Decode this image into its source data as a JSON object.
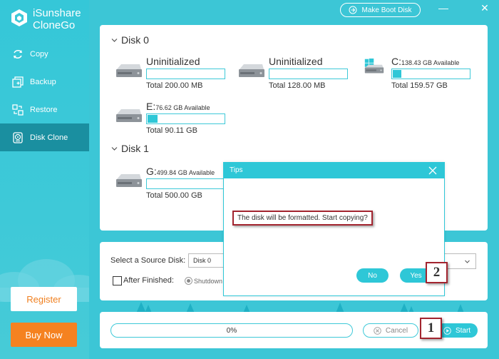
{
  "app": {
    "name_line1": "iSunshare",
    "name_line2": "CloneGo"
  },
  "sidebar": {
    "items": [
      {
        "label": "Copy",
        "icon": "copy-icon",
        "active": false
      },
      {
        "label": "Backup",
        "icon": "backup-icon",
        "active": false
      },
      {
        "label": "Restore",
        "icon": "restore-icon",
        "active": false
      },
      {
        "label": "Disk Clone",
        "icon": "disk-clone-icon",
        "active": true
      }
    ],
    "register_label": "Register",
    "buy_label": "Buy Now"
  },
  "topbar": {
    "boot_disk_label": "Make Boot Disk",
    "minimize_glyph": "—",
    "close_glyph": "✕"
  },
  "disks": [
    {
      "title": "Disk 0",
      "partitions": [
        {
          "letter": "Uninitialized",
          "available": "",
          "total": "Total 200.00 MB",
          "fill_percent": 0,
          "icon": "hard-drive-icon"
        },
        {
          "letter": "Uninitialized",
          "available": "",
          "total": "Total 128.00 MB",
          "fill_percent": 0,
          "icon": "hard-drive-icon"
        },
        {
          "letter": "C:",
          "available": "138.43 GB Available",
          "total": "Total 159.57 GB",
          "fill_percent": 13,
          "icon": "windows-drive-icon"
        },
        {
          "letter": "E:",
          "available": "76.62 GB Available",
          "total": "Total 90.11 GB",
          "fill_percent": 15,
          "icon": "hard-drive-icon"
        }
      ]
    },
    {
      "title": "Disk 1",
      "partitions": [
        {
          "letter": "G:",
          "available": "499.84 GB Available",
          "total": "Total 500.00 GB",
          "fill_percent": 0,
          "icon": "hard-drive-icon"
        }
      ]
    }
  ],
  "source": {
    "label": "Select a Source Disk:",
    "selected": "Disk 0",
    "after_finished_label": "After Finished:",
    "shutdown_label": "Shutdown"
  },
  "progress": {
    "text": "0%",
    "value": 0,
    "cancel_label": "Cancel",
    "start_label": "Start"
  },
  "dialog": {
    "title": "Tips",
    "message": "The disk will be formatted. Start copying?",
    "no_label": "No",
    "yes_label": "Yes"
  },
  "callouts": {
    "one": "1",
    "two": "2"
  },
  "colors": {
    "accent": "#2ec7d7",
    "sidebar_active": "#1a8fa0",
    "buy": "#f58220",
    "callout_border": "#a2242f"
  }
}
